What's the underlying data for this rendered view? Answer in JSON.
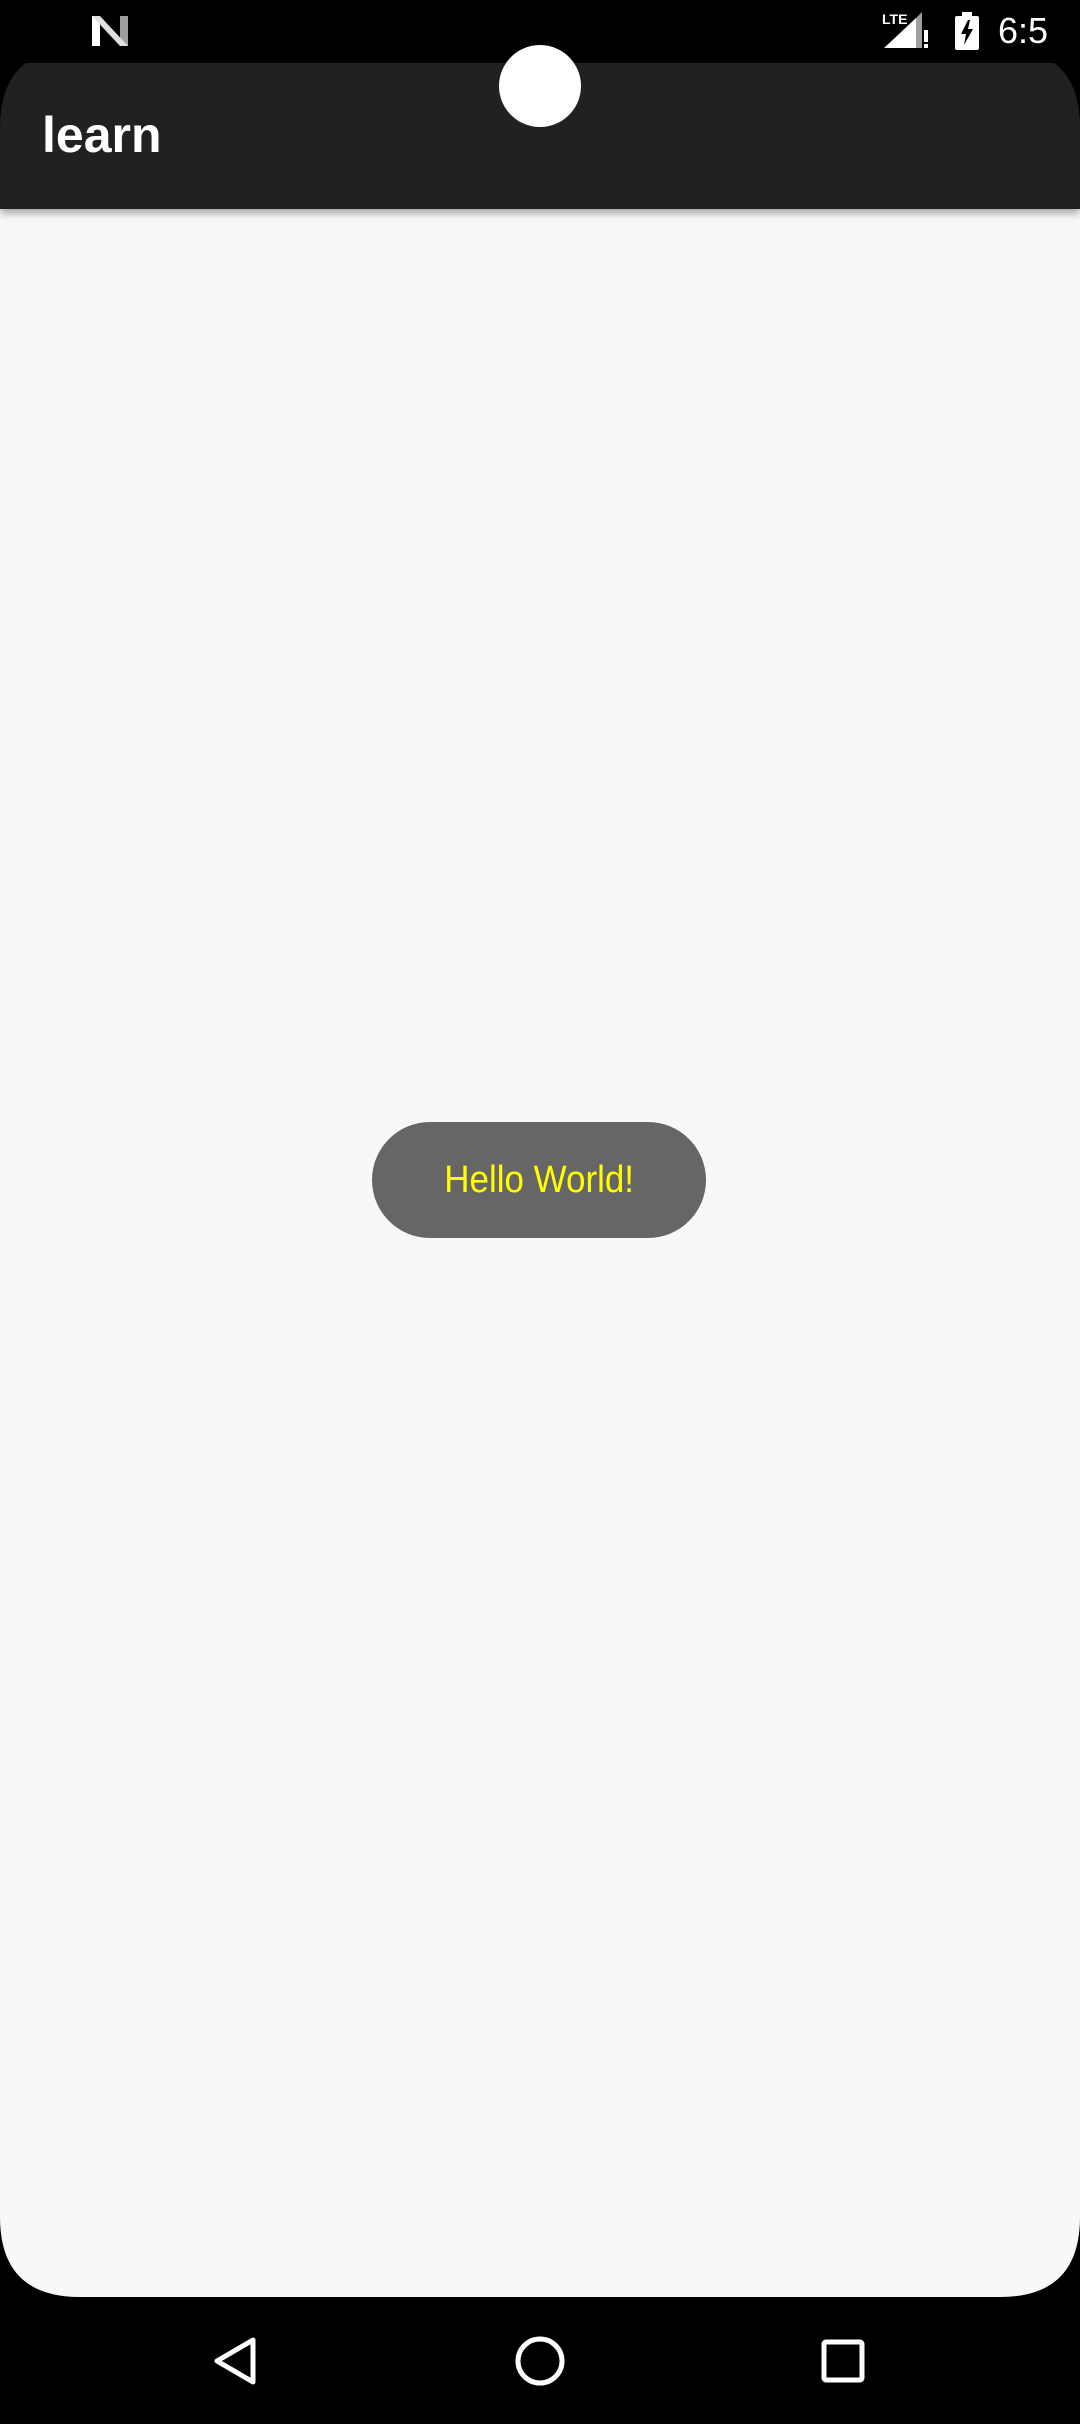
{
  "status_bar": {
    "clock": "6:5",
    "network_label": "LTE",
    "left_icon": "notification-n-icon",
    "signal_icon": "signal-lte-alert-icon",
    "battery_icon": "battery-charging-icon"
  },
  "app_bar": {
    "title": "learn"
  },
  "toast": {
    "message": "Hello World!"
  },
  "nav_bar": {
    "back_icon": "back-triangle-icon",
    "home_icon": "home-circle-icon",
    "recents_icon": "recents-square-icon"
  },
  "colors": {
    "app_bar_bg": "#212121",
    "content_bg": "#f8f8f8",
    "toast_bg": "#666666",
    "toast_text": "#ffff00",
    "system_bars": "#000000"
  }
}
